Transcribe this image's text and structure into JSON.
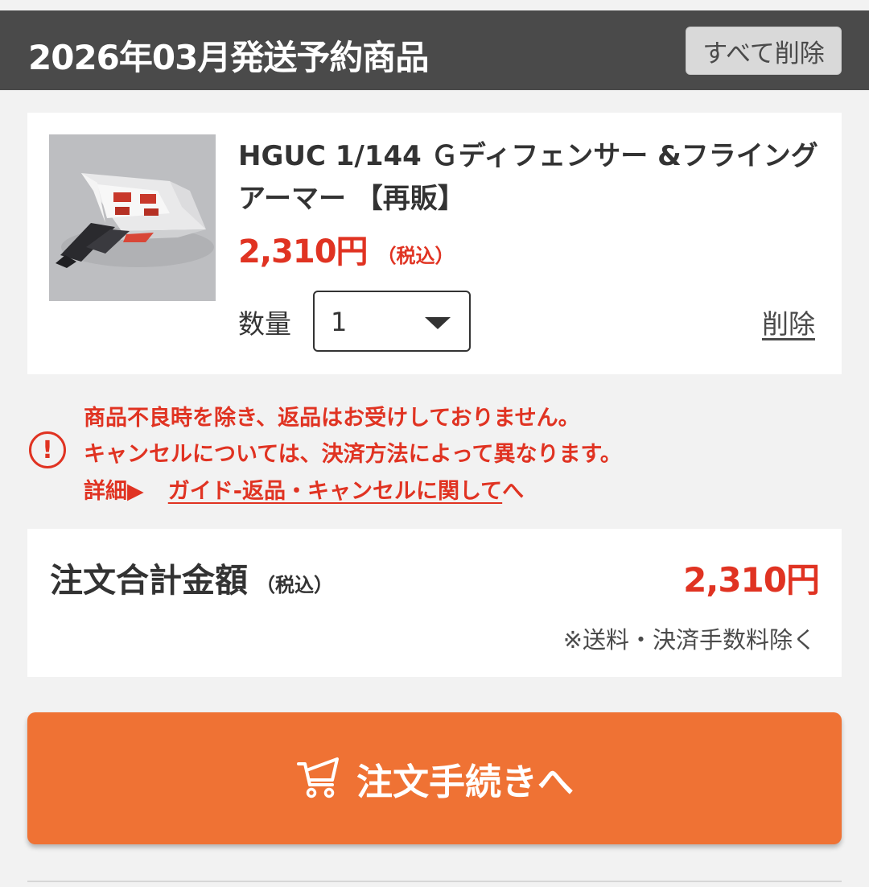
{
  "header": {
    "title": "2026年03月発送予約商品",
    "delete_all_label": "すべて削除"
  },
  "item": {
    "name": "HGUC 1/144 Ｇディフェンサー &フライングアーマー 【再販】",
    "price": "2,310円",
    "price_tax_note": "（税込）",
    "quantity_label": "数量",
    "quantity_value": "1",
    "delete_label": "削除"
  },
  "notice": {
    "line1": "商品不良時を除き、返品はお受けしておりません。",
    "line2": "キャンセルについては、決済方法によって異なります。",
    "detail_label": "詳細▶",
    "link_text": "ガイド-返品・キャンセルに関して",
    "link_suffix": "へ",
    "icon": "exclamation-circle-icon"
  },
  "total": {
    "label": "注文合計金額",
    "tax_note": "（税込）",
    "value": "2,310円",
    "note": "※送料・決済手数料除く"
  },
  "order_button": {
    "label": "注文手続きへ",
    "icon": "cart-icon"
  },
  "colors": {
    "accent_red": "#e03322",
    "header_bg": "#4a4a4a",
    "button_orange": "#ef7234",
    "page_bg": "#f2f2f2"
  }
}
